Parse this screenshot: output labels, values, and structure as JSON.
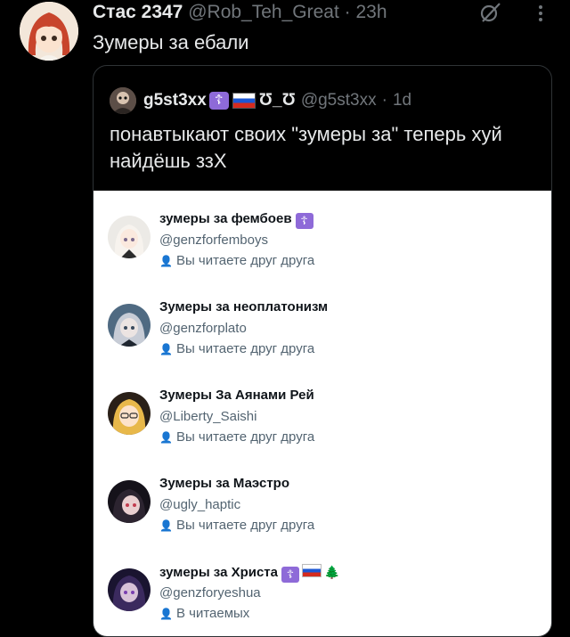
{
  "tweet": {
    "display_name": "Стас 2347",
    "handle": "@Rob_Teh_Great",
    "separator": "·",
    "time": "23h",
    "text": "Зумеры за ебали"
  },
  "quote": {
    "display_name": "g5st3xx",
    "badge": "☦",
    "face": "Ʊ_Ʊ",
    "handle": "@g5st3xx",
    "separator": "·",
    "time": "1d",
    "text": "понавтыкают своих \"зумеры за\" теперь хуй найдёшь ззХ"
  },
  "accounts": [
    {
      "name": "зумеры за фембоев",
      "handle": "@genzforfemboys",
      "status": "Вы читаете друг друга",
      "badge": "☦",
      "flag": false,
      "tree": false
    },
    {
      "name": "Зумеры за неоплатонизм",
      "handle": "@genzforplato",
      "status": "Вы читаете друг друга",
      "badge": "",
      "flag": false,
      "tree": false
    },
    {
      "name": "Зумеры За Аянами Рей",
      "handle": "@Liberty_Saishi",
      "status": "Вы читаете друг друга",
      "badge": "",
      "flag": false,
      "tree": false
    },
    {
      "name": "Зумеры за Маэстро",
      "handle": "@ugly_haptic",
      "status": "Вы читаете друг друга",
      "badge": "",
      "flag": false,
      "tree": false
    },
    {
      "name": "зумеры за Христа",
      "handle": "@genzforyeshua",
      "status": "В читаемых",
      "badge": "☦",
      "flag": true,
      "tree": true
    }
  ],
  "icons": {
    "person": "👤",
    "tree": "🌲"
  }
}
